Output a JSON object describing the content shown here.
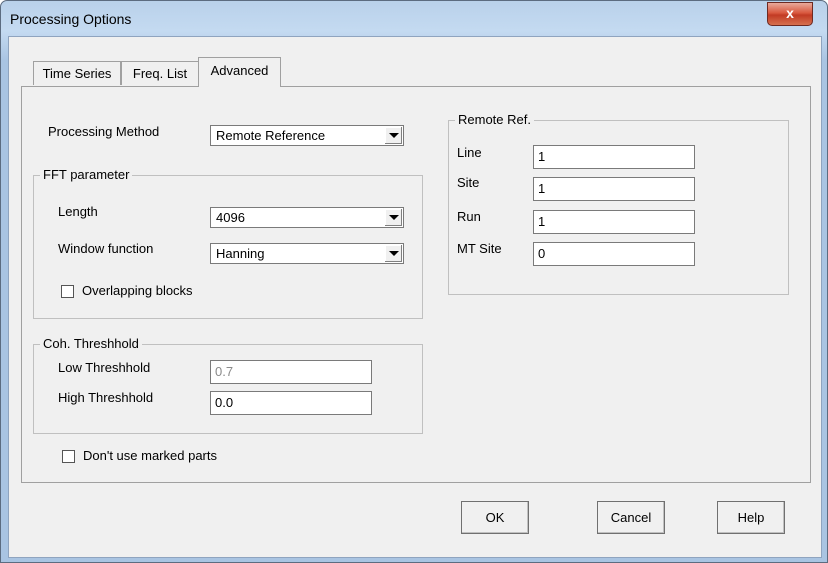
{
  "window": {
    "title": "Processing Options",
    "close_glyph": "x"
  },
  "tabs": [
    {
      "label": "Time Series"
    },
    {
      "label": "Freq. List"
    },
    {
      "label": "Advanced",
      "active": true
    }
  ],
  "processing": {
    "method_label": "Processing Method",
    "method_value": "Remote Reference"
  },
  "fft": {
    "group_label": "FFT parameter",
    "length_label": "Length",
    "length_value": "4096",
    "window_label": "Window function",
    "window_value": "Hanning",
    "overlap_label": "Overlapping blocks",
    "overlap_checked": false
  },
  "coh": {
    "group_label": "Coh. Threshhold",
    "low_label": "Low Threshhold",
    "low_value": "0.7",
    "high_label": "High Threshhold",
    "high_value": "0.0"
  },
  "marked": {
    "label": "Don't use marked parts",
    "checked": false
  },
  "remote_ref": {
    "group_label": "Remote Ref.",
    "fields": [
      {
        "label": "Line",
        "value": "1"
      },
      {
        "label": "Site",
        "value": "1"
      },
      {
        "label": "Run",
        "value": "1"
      },
      {
        "label": "MT Site",
        "value": "0"
      }
    ]
  },
  "buttons": {
    "ok": "OK",
    "cancel": "Cancel",
    "help": "Help"
  },
  "icons": {
    "close": "close-icon",
    "dropdown": "dropdown-arrow-icon"
  }
}
